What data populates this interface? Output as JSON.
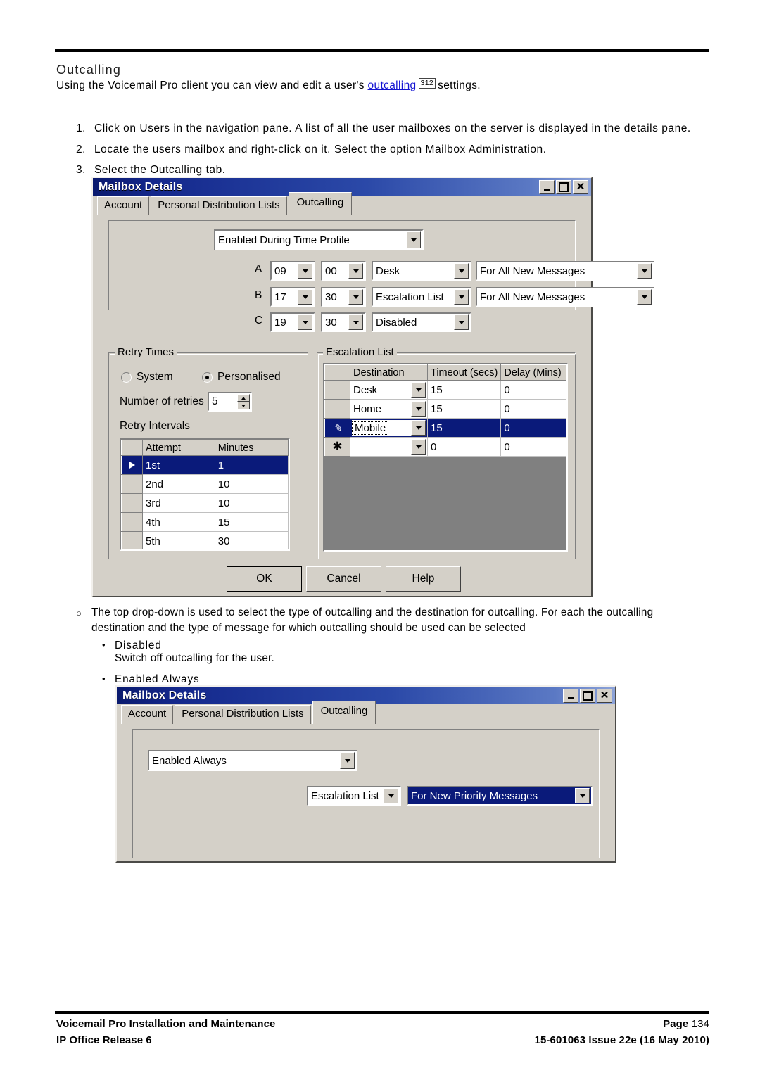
{
  "document": {
    "heading": "Outcalling",
    "intro_before": "Using the Voicemail Pro client you can view and edit a user's ",
    "intro_link": "outcalling",
    "intro_pageref": "312",
    "intro_after": "settings.",
    "steps": [
      {
        "num": "1.",
        "text": "Click on Users in the navigation pane. A list of all the user mailboxes on the server is displayed in the details pane."
      },
      {
        "num": "2.",
        "text": "Locate the users mailbox and right-click on it. Select the option Mailbox Administration."
      },
      {
        "num": "3.",
        "text": "Select the Outcalling tab."
      }
    ],
    "bullets": {
      "main_line1": "The top drop-down is used to select the type of outcalling and the destination for outcalling. For each the outcalling",
      "main_line2": "destination and the type of message for which outcalling should be used can be selected",
      "sub": [
        {
          "label": "Disabled",
          "desc": "Switch off outcalling for the user."
        },
        {
          "label": "Enabled Always",
          "desc": ""
        }
      ]
    }
  },
  "dialog1": {
    "title": "Mailbox Details",
    "window_buttons": {
      "minimize": "minimize-icon",
      "maximize": "maximize-icon",
      "close": "close-icon"
    },
    "tabs": [
      {
        "label": "Account",
        "active": false
      },
      {
        "label": "Personal Distribution Lists",
        "active": false
      },
      {
        "label": "Outcalling",
        "active": true
      }
    ],
    "mode_combo": {
      "value": "Enabled During Time Profile"
    },
    "time_rows": [
      {
        "label": "A",
        "hour": "09",
        "minute": "00",
        "destination": "Desk",
        "messages": "For All New Messages",
        "has_messages": true
      },
      {
        "label": "B",
        "hour": "17",
        "minute": "30",
        "destination": "Escalation List",
        "messages": "For All New Messages",
        "has_messages": true
      },
      {
        "label": "C",
        "hour": "19",
        "minute": "30",
        "destination": "Disabled",
        "messages": "",
        "has_messages": false
      }
    ],
    "retry_times": {
      "group_title": "Retry Times",
      "radio_system": "System",
      "radio_personalised": "Personalised",
      "selected": "Personalised",
      "retries_label": "Number of retries",
      "retries_value": "5",
      "intervals_label": "Retry Intervals",
      "columns": [
        "Attempt",
        "Minutes"
      ],
      "rows": [
        {
          "marker": "arrow",
          "attempt": "1st",
          "minutes": "1",
          "selected": true
        },
        {
          "marker": "",
          "attempt": "2nd",
          "minutes": "10",
          "selected": false
        },
        {
          "marker": "",
          "attempt": "3rd",
          "minutes": "10",
          "selected": false
        },
        {
          "marker": "",
          "attempt": "4th",
          "minutes": "15",
          "selected": false
        },
        {
          "marker": "",
          "attempt": "5th",
          "minutes": "30",
          "selected": false
        }
      ]
    },
    "escalation_list": {
      "group_title": "Escalation List",
      "columns": [
        "Destination",
        "Timeout (secs)",
        "Delay (Mins)"
      ],
      "rows": [
        {
          "marker": "",
          "destination": "Desk",
          "timeout": "15",
          "delay": "0",
          "selected": false,
          "editing": false
        },
        {
          "marker": "",
          "destination": "Home",
          "timeout": "15",
          "delay": "0",
          "selected": false,
          "editing": false
        },
        {
          "marker": "pencil",
          "destination": "Mobile",
          "timeout": "15",
          "delay": "0",
          "selected": true,
          "editing": true
        },
        {
          "marker": "asterisk",
          "destination": "",
          "timeout": "0",
          "delay": "0",
          "selected": false,
          "editing": false
        }
      ]
    },
    "buttons": {
      "ok": "OK",
      "cancel": "Cancel",
      "help": "Help"
    }
  },
  "dialog2": {
    "title": "Mailbox Details",
    "window_buttons": {
      "minimize": "minimize-icon",
      "maximize": "maximize-icon",
      "close": "close-icon"
    },
    "tabs": [
      {
        "label": "Account",
        "active": false
      },
      {
        "label": "Personal Distribution Lists",
        "active": false
      },
      {
        "label": "Outcalling",
        "active": true
      }
    ],
    "mode_combo": {
      "value": "Enabled Always"
    },
    "destination_combo": {
      "value": "Escalation List"
    },
    "messages_combo": {
      "value": "For New Priority Messages",
      "selected": true
    }
  },
  "footer": {
    "left_line1": "Voicemail Pro Installation and Maintenance",
    "left_line2": "IP Office Release 6",
    "right_line1_label": "Page",
    "right_line1_value": "134",
    "right_line2": "15-601063 Issue 22e (16 May 2010)"
  },
  "colors": {
    "link": "#1414d2",
    "title_bar_start": "#0a1a6e",
    "title_bar_end": "#8da3d8",
    "dialog_face": "#d4d0c8",
    "selection": "#0a1a7a",
    "grid_empty": "#808080"
  }
}
